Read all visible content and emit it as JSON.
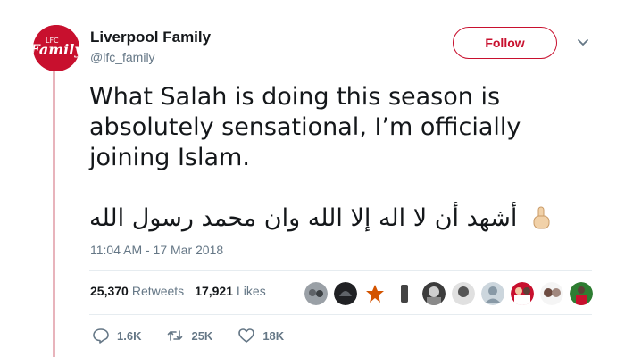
{
  "account": {
    "avatar_text": "Family",
    "display_name": "Liverpool Family",
    "handle": "@lfc_family"
  },
  "follow_label": "Follow",
  "tweet": {
    "lines": [
      "What Salah is doing this season is",
      "absolutely sensational, I’m officially",
      "joining Islam."
    ],
    "arabic": "أشهد أن لا اله إلا الله وان محمد رسول الله",
    "timestamp": "11:04 AM - 17 Mar 2018"
  },
  "stats": {
    "retweets_count": "25,370",
    "retweets_label": "Retweets",
    "likes_count": "17,921",
    "likes_label": "Likes"
  },
  "likers": [
    {
      "icon": "avatar-group-photo"
    },
    {
      "icon": "avatar-dark-helmet"
    },
    {
      "icon": "avatar-leaf"
    },
    {
      "icon": "avatar-bottle"
    },
    {
      "icon": "avatar-bw-photo"
    },
    {
      "icon": "avatar-bw-face"
    },
    {
      "icon": "avatar-default"
    },
    {
      "icon": "avatar-red-players"
    },
    {
      "icon": "avatar-couple"
    },
    {
      "icon": "avatar-red-player"
    }
  ],
  "actions": {
    "reply_count": "1.6K",
    "retweet_count": "25K",
    "like_count": "18K"
  },
  "colors": {
    "accent": "#c8102e",
    "thread_line": "#e8b4bc",
    "muted": "#657786",
    "text": "#14171a",
    "divider": "#e6ecf0"
  }
}
